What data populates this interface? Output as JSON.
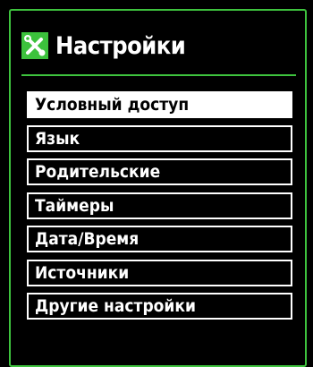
{
  "header": {
    "icon": "settings-tools-icon",
    "title": "Настройки"
  },
  "colors": {
    "accent": "#3ec33e",
    "background": "#000000",
    "text": "#ffffff",
    "selected_bg": "#ffffff",
    "selected_text": "#000000"
  },
  "menu": {
    "selected_index": 0,
    "items": [
      {
        "label": "Условный доступ"
      },
      {
        "label": "Язык"
      },
      {
        "label": "Родительские"
      },
      {
        "label": "Таймеры"
      },
      {
        "label": "Дата/Время"
      },
      {
        "label": "Источники"
      },
      {
        "label": "Другие настройки"
      }
    ]
  }
}
